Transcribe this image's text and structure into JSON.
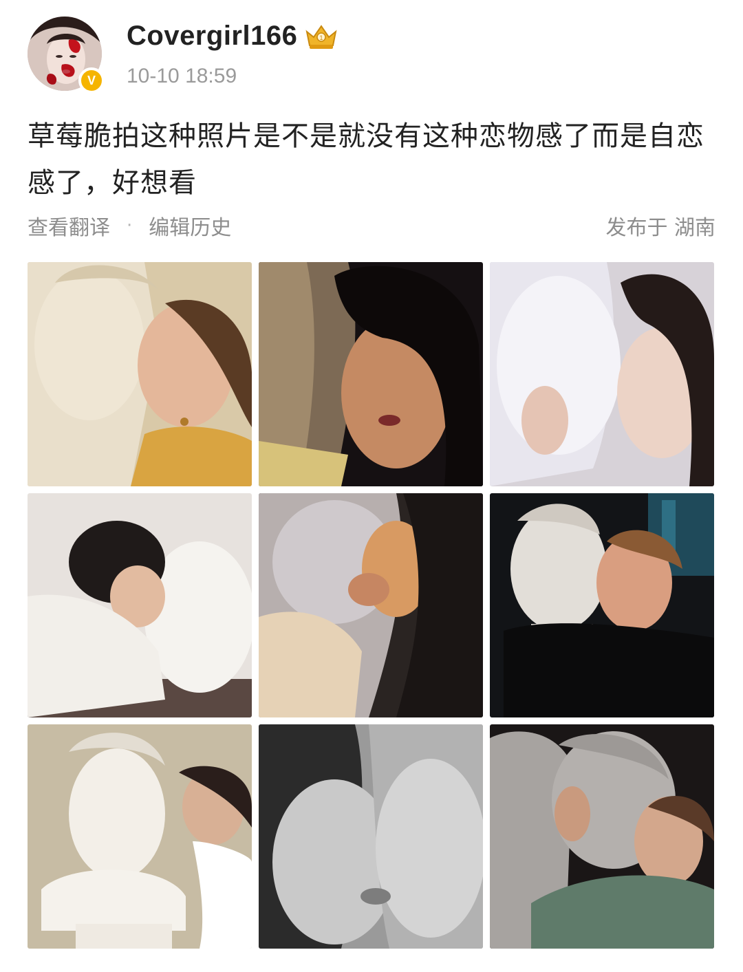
{
  "post": {
    "username": "Covergirl166",
    "timestamp": "10-10 18:59",
    "verified_badge": "V",
    "text": "草莓脆拍这种照片是不是就没有这种恋物感了而是自恋感了，好想看",
    "translate_label": "查看翻译",
    "separator": "·",
    "edit_history_label": "编辑历史",
    "location": "发布于 湖南"
  },
  "icons": {
    "crown": "crown-badge-icon",
    "verified": "verified-v-icon"
  },
  "colors": {
    "verified": "#f5b400",
    "crown": "#e8a317",
    "meta_text": "#8d8d8d"
  }
}
